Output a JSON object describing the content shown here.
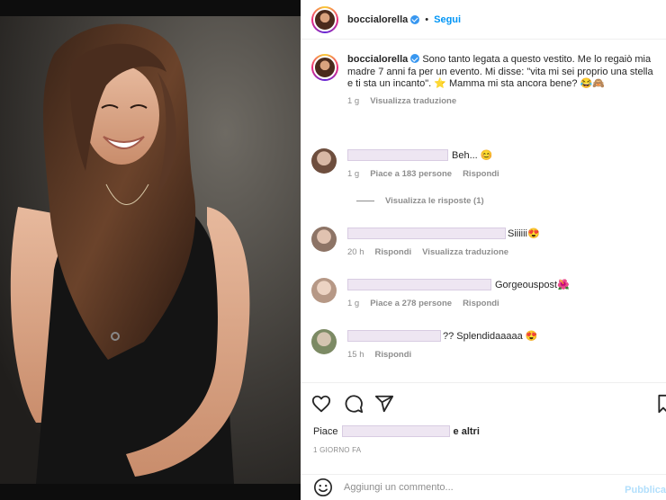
{
  "post": {
    "username": "boccialorella",
    "follow_label": "Segui",
    "dot": "•",
    "caption_text": "Sono tanto legata a questo vestito. Me lo regaiò mia madre 7 anni fa per un evento. Mi disse: \"vita mi sei proprio una stella e ti sta un incanto\". ⭐ Mamma mi sta ancora bene? 😂🙈",
    "caption_time": "1 g",
    "caption_translate": "Visualizza traduzione"
  },
  "comments": [
    {
      "text": "Beh... 😊",
      "time": "1 g",
      "likes": "Piace a 183 persone",
      "reply": "Rispondi"
    },
    {
      "text": "Siiiiii😍",
      "time": "20 h",
      "reply": "Rispondi",
      "translate": "Visualizza traduzione"
    },
    {
      "text": "Gorgeouspost🌺",
      "time": "1 g",
      "likes": "Piace a 278 persone",
      "reply": "Rispondi"
    },
    {
      "text": "?? Splendidaaaaa 😍",
      "time": "15 h",
      "reply": "Rispondi"
    }
  ],
  "replies_label": "Visualizza le risposte (1)",
  "likes_line": {
    "prefix": "Piace",
    "suffix": "e altri"
  },
  "post_date": "1 GIORNO FA",
  "add_comment": {
    "placeholder": "Aggiungi un commento...",
    "publish": "Pubblica"
  },
  "icons": {
    "like": "heart-icon",
    "comment": "comment-icon",
    "share": "share-icon",
    "save": "bookmark-icon",
    "emoji": "emoji-icon"
  },
  "colors": {
    "accent": "#0095f6",
    "verified": "#3897f0",
    "muted": "#8e8e8e"
  }
}
